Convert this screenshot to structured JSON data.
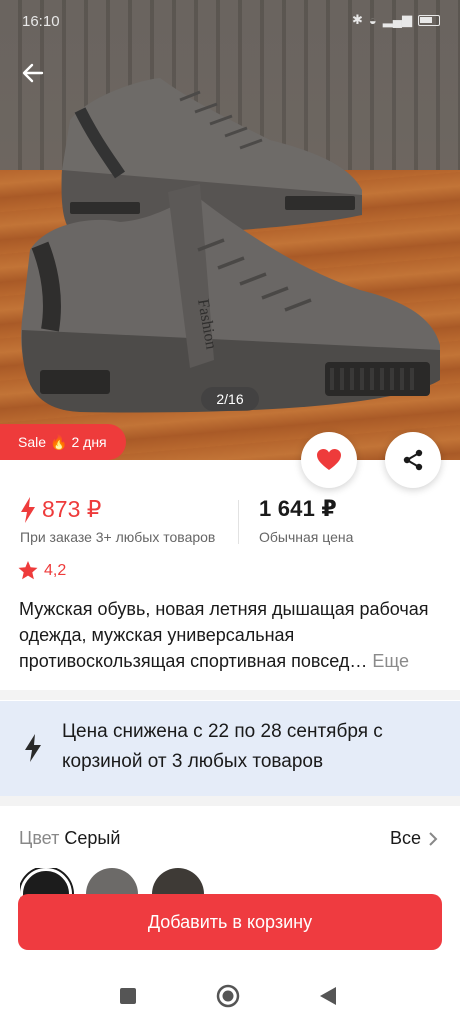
{
  "status": {
    "time": "16:10"
  },
  "gallery": {
    "pager": "2/16",
    "print_text": "Fashion"
  },
  "sale_badge": {
    "label": "Sale",
    "emoji": "🔥",
    "duration": "2 дня"
  },
  "price": {
    "bulk_price": "873 ₽",
    "bulk_caption": "При заказе 3+ любых товаров",
    "regular_price": "1 641 ₽",
    "regular_caption": "Обычная цена"
  },
  "rating": {
    "value": "4,2"
  },
  "product": {
    "title": "Мужская обувь, новая летняя дышащая рабочая одежда, мужская универсальная противоскользящая спортивная повсед…",
    "more_label": "Еще"
  },
  "promo": {
    "text": "Цена снижена с 22 по 28 сентября с корзиной от 3 любых товаров"
  },
  "color": {
    "label": "Цвет",
    "selected": "Серый",
    "all_label": "Все"
  },
  "actions": {
    "add_to_cart": "Добавить в корзину"
  },
  "colors": {
    "accent": "#ee3b3b",
    "promo_bg": "#e5ecf8"
  },
  "icons": [
    "back-arrow-icon",
    "heart-icon",
    "share-icon",
    "lightning-icon",
    "star-icon",
    "chevron-right-icon",
    "nav-square-icon",
    "nav-home-icon",
    "nav-back-icon"
  ]
}
